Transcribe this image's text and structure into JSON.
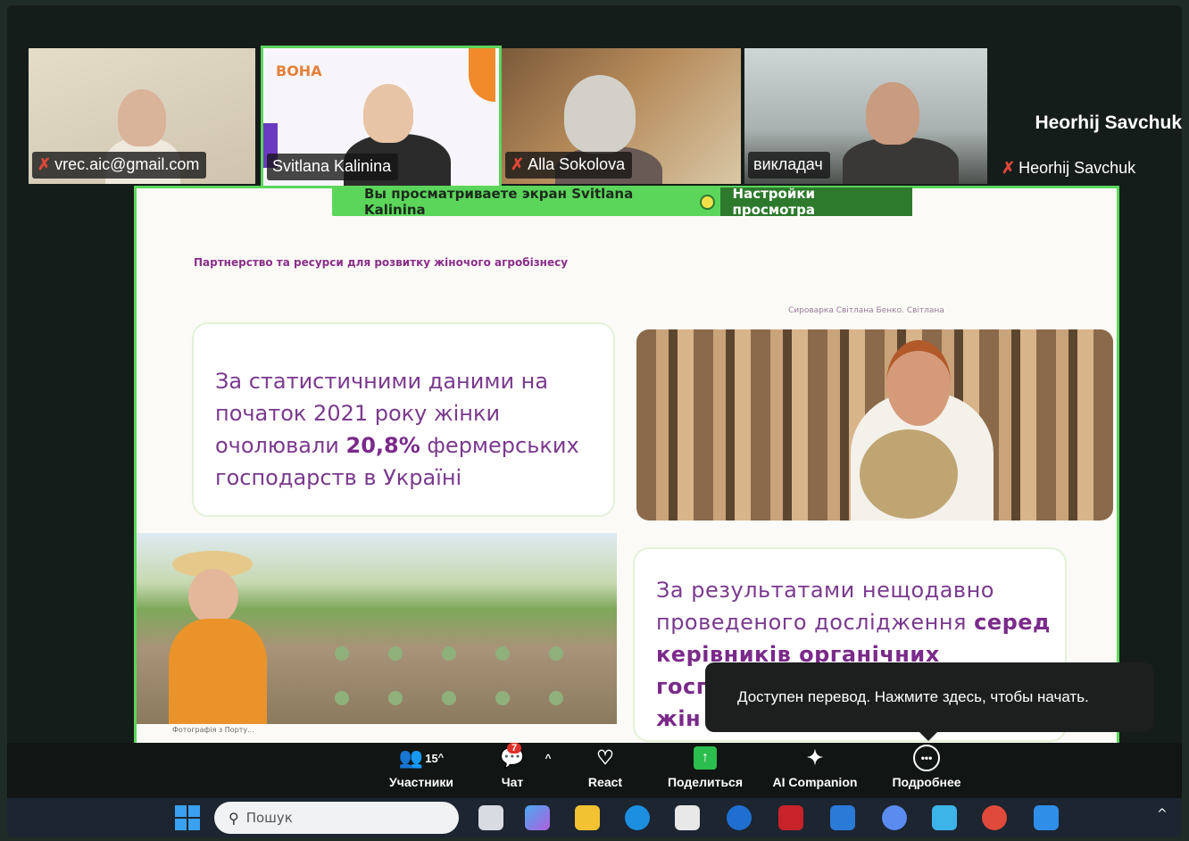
{
  "participants": [
    {
      "name": "vrec.aic@gmail.com",
      "muted": true
    },
    {
      "name": "Svitlana Kalinina",
      "muted": false,
      "logo": "ВОНА"
    },
    {
      "name": "Alla Sokolova",
      "muted": true
    },
    {
      "name": "викладач",
      "muted": false
    },
    {
      "name": "Heorhij Savchuk",
      "muted": true,
      "display_name": "Heorhij Savchuk"
    }
  ],
  "share_bar": {
    "text": "Вы просматриваете экран  Svitlana Kalinina",
    "settings": "Настройки просмотра"
  },
  "slide": {
    "title": "Партнерство та ресурси для розвитку жіночого агробізнесу",
    "photo_caption": "Сироварка Світлана Бенко. Світлана",
    "card1_text_1": "За статистичними даними на",
    "card1_text_2": "початок 2021 року жінки",
    "card1_text_3_a": "очолювали ",
    "card1_text_3_b": "20,8%",
    "card1_text_3_c": " фермерських",
    "card1_text_4": "господарств в Україні",
    "card2_text_1": "За результатами нещодавно",
    "card2_text_2_a": "проведеного дослідження ",
    "card2_text_2_b": "серед",
    "card2_text_3": "керівників органічних",
    "card2_text_4": "госп",
    "card2_text_5": "жін",
    "under_caption": "Фотографія з Порту..."
  },
  "tooltip": "Доступен перевод. Нажмите здесь, чтобы начать.",
  "toolbar": {
    "participants_label": "Участники",
    "participants_count": "15",
    "chat_label": "Чат",
    "chat_badge": "7",
    "react_label": "React",
    "share_label": "Поделиться",
    "ai_label": "AI Companion",
    "more_label": "Подробнее"
  },
  "taskbar": {
    "search_placeholder": "Пошук"
  }
}
